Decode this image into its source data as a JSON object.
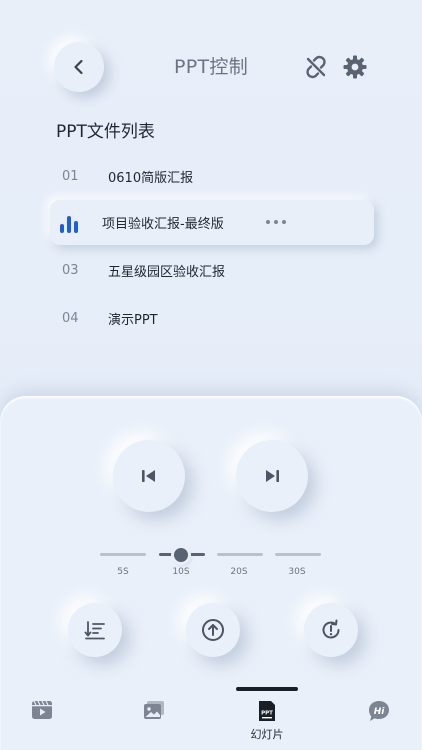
{
  "header": {
    "title": "PPT控制",
    "back_icon": "chevron-left-icon",
    "link_icon": "link-broken-icon",
    "settings_icon": "gear-icon"
  },
  "file_list": {
    "title": "PPT文件列表",
    "items": [
      {
        "num": "01",
        "name": "0610简版汇报"
      },
      {
        "num": "",
        "name": "项目验收汇报-最终版",
        "active": true,
        "status_icon": "playing-bars-icon",
        "more_icon": "more-dots-icon"
      },
      {
        "num": "03",
        "name": "五星级园区验收汇报"
      },
      {
        "num": "04",
        "name": "演示PPT"
      }
    ]
  },
  "controls": {
    "prev_icon": "skip-previous-icon",
    "next_icon": "skip-next-icon",
    "interval_options": [
      "5S",
      "10S",
      "20S",
      "30S"
    ],
    "interval_selected": "10S",
    "actions": [
      {
        "icon": "list-order-icon"
      },
      {
        "icon": "upload-circle-icon"
      },
      {
        "icon": "refresh-alert-icon"
      }
    ]
  },
  "tabbar": {
    "tabs": [
      {
        "icon": "video-icon",
        "label": ""
      },
      {
        "icon": "gallery-icon",
        "label": ""
      },
      {
        "icon": "ppt-icon",
        "label": "幻灯片",
        "active": true
      },
      {
        "icon": "hi-chat-icon",
        "label": ""
      }
    ]
  },
  "colors": {
    "accent": "#1f5fd6",
    "background": "#e6eefa",
    "text": "#1f2733",
    "muted": "#7d8593"
  }
}
